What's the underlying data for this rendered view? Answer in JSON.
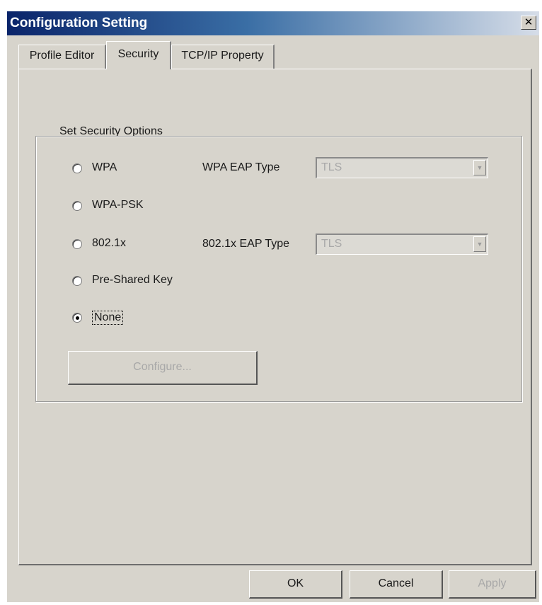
{
  "window": {
    "title": "Configuration Setting",
    "close_symbol": "✕"
  },
  "tabs": [
    {
      "label": "Profile Editor",
      "active": false
    },
    {
      "label": "Security",
      "active": true
    },
    {
      "label": "TCP/IP Property",
      "active": false
    }
  ],
  "security": {
    "group_label": "Set Security Options",
    "options": [
      {
        "label": "WPA",
        "selected": false
      },
      {
        "label": "WPA-PSK",
        "selected": false
      },
      {
        "label": "802.1x",
        "selected": false
      },
      {
        "label": "Pre-Shared Key",
        "selected": false
      },
      {
        "label": "None",
        "selected": true
      }
    ],
    "wpa_eap_label": "WPA EAP Type",
    "wpa_eap_value": "TLS",
    "dot1x_eap_label": "802.1x EAP Type",
    "dot1x_eap_value": "TLS",
    "configure_label": "Configure...",
    "configure_enabled": false
  },
  "footer": {
    "ok_label": "OK",
    "cancel_label": "Cancel",
    "apply_label": "Apply",
    "apply_enabled": false
  },
  "colors": {
    "titlebar_start": "#0a246a",
    "titlebar_end": "#d6dde8",
    "dialog_face": "#d7d4cc",
    "disabled_text": "#a8a8a8"
  },
  "icons": {
    "close": "close-icon",
    "dropdown": "chevron-down-icon"
  }
}
